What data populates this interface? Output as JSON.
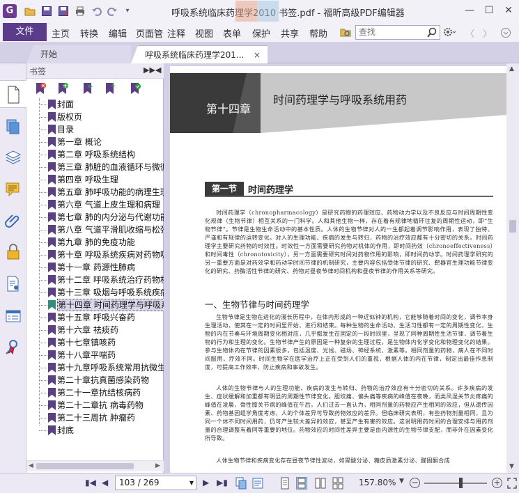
{
  "app": {
    "logo_letter": "G",
    "window_title": "呼吸系统临床药理学2010 书签.pdf - 福昕高级PDF编辑器",
    "minimize": "—",
    "maximize": "☐",
    "close": "✕"
  },
  "menu": {
    "file": "文件",
    "items": [
      "主页",
      "转换",
      "编辑",
      "页面管",
      "注释",
      "视图",
      "表单",
      "保护",
      "共享",
      "帮助"
    ],
    "search_placeholder": "查找"
  },
  "tabs": [
    {
      "label": "开始"
    },
    {
      "label": "呼吸系统临床药理学201...",
      "close": "×"
    }
  ],
  "bookmark_panel": {
    "title": "书签",
    "expand_btn": "▶▶",
    "collapse_btn": "◀",
    "items": [
      {
        "label": "封面"
      },
      {
        "label": "版权页"
      },
      {
        "label": "目录"
      },
      {
        "label": "第一章 概论"
      },
      {
        "label": "第二章 呼吸系统结构"
      },
      {
        "label": "第三章 肺脏的血液循环与微循"
      },
      {
        "label": "第四章 呼吸生理"
      },
      {
        "label": "第五章 肺呼吸功能的病理生理"
      },
      {
        "label": "第六章 气道上皮生理和病理"
      },
      {
        "label": "第七章 肺的内分泌与代谢功能"
      },
      {
        "label": "第八章 气道平滑肌收缩与松弛"
      },
      {
        "label": "第九章 肺的免疫功能"
      },
      {
        "label": "第十章 呼吸系统疾病对药物吸"
      },
      {
        "label": "第十一章 药源性肺病"
      },
      {
        "label": "第十二章 呼吸系统治疗药物相"
      },
      {
        "label": "第十三章 吸烟与呼吸系统疾病"
      },
      {
        "label": "第十四章 时间药理学与呼吸系",
        "selected": true
      },
      {
        "label": "第十五章 呼吸兴奋药"
      },
      {
        "label": "第十六章 祛痰药"
      },
      {
        "label": "第十七章镇咳药"
      },
      {
        "label": "第十八章平喘药"
      },
      {
        "label": "第十九章呼吸系统常用抗微生"
      },
      {
        "label": "第二十章抗真菌感染药物"
      },
      {
        "label": "第二十一章抗结核病药"
      },
      {
        "label": "第二十二章抗 病毒药物"
      },
      {
        "label": "第二十三周抗 肿瘤药"
      },
      {
        "label": "封底"
      }
    ]
  },
  "page": {
    "chapter_num": "第十四章",
    "chapter_title": "时间药理学与呼吸系统用药",
    "section_num": "第一节",
    "section_title": "时间药理学",
    "para1": "时间药理学（chronopharmacology）是研究药物的药理效应、药物动力学以及不良反应与时间周期性变化规律（生物节律）相互关系的一门科学。人和其他生物一样，存在着有规律地循环往复的周期性运动，即“生物节律”。节律是生物生命活动中的基本性质。人体的生物节律对人的一生都起着调节影响作用，表现了独特、严谨和有规律的运转变化。对人的生理功能、疾病的发生与转归，药物的治疗效应都有十分密切的关系。时间药理学主要研究药物的时效性。时效性一方面需要研究药物对机体的作用，即时间药效（chronoeffectiveness）和时间毒性（chronotoxicity），另一方面需要研究时间对药物作用的影响，即时间药动学。时间药理学研究的另一重要方面是对药效学和药动学时间节律的机制研究，主要内容包括受体节律的研究、靶器官生理功能节律变化的研究、药酶活性节律的研究、药物对昼夜节律时间机构和昼夜节律的作用关系等研究。",
    "subhead": "一、生物节律与时间药理学",
    "para2": "生物节律是生物在进化的漫长历程中，在体内形成的一种近似钟的机构，它能够随着时间的变化，调节本身生理活动，使其在一定的时间里开始、进行和结束。每种生物的生命活动、生活习性都有一定的周期性变化，生物的内在节奏与环境周期变化相对应，几乎都发生在固定的一段时间里，呈现了同种周期性生活节律，调节着生物的行为和生理的变化。生物节律产生的原因是一种复杂的生理过程，是生物体内化学变化和物理变化的结果。参与生物体内在节律的因素很多，包括温度、光线、磁场、神经系统、激素等。相同剂量的药物，病人在不同时间服用，疗效不同。时间生物学在医学治疗上正在受到人们的重视，根据人体的内在节律，制定出最佳作息制度，可提高工作效率，防止疾病和事故发生。",
    "para3": "人体的生物节律与人的生理功能、疾病的发生与转归、药物的治疗效应有十分密切的关系。许多疾病的发生、症状缓解和加重都有明显的周期性节律变化。胆绞痛、偏头痛等疾病的峰值在夜晚，而类风湿关节炎疼痛的峰值在凌晨，骨性膝关节病的峰值在午后。人们过去一直认为，相同剂量的药物应产生相同的效应，但从遗传因素、药物基因组学角度考虑，人的个体差异可导致药物效应的差异。但临床研究表明，有些药物剂量相同，且为同一个体不同时间用药，仍可产生较大差异的效应，甚至产生有害的效应。这说明用药时间的合理安排与用药剂量的合理调整有着同等重要的地位。药物效应的时间性差异主要是由内源性的生物节律支配，而非外在因素变化所导致。",
    "para4": "人体生物节律和疾病变化存在昼夜节律性波动，如胃酸分泌、糖皮质激素分泌、醛固酮合成"
  },
  "status": {
    "page_display": "103 / 269",
    "zoom": "157.80%",
    "zoom_level_fraction": 0.58,
    "zoom_minus": "−",
    "zoom_plus": "+"
  }
}
